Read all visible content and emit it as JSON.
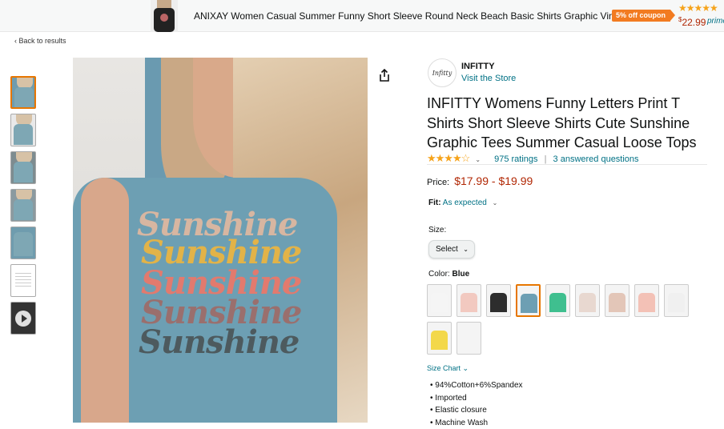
{
  "banner": {
    "title": "ANIXAY Women Casual Summer Funny Short Sleeve Round Neck Beach Basic Shirts Graphic Vintage...",
    "coupon": "5% off coupon",
    "stars": "★★★★★",
    "price_symbol": "$",
    "price": "22.99",
    "prime": "prime"
  },
  "nav": {
    "back": "‹  Back to results"
  },
  "gallery": {
    "thumbnails": [
      "Image 1",
      "Image 2",
      "Image 3",
      "Image 4",
      "Image 5",
      "Size chart",
      "Video"
    ],
    "main_words": [
      "Sunshine",
      "Sunshine",
      "Sunshine",
      "Sunshine",
      "Sunshine"
    ]
  },
  "store": {
    "logo_text": "Infitty",
    "brand": "INFITTY",
    "visit": "Visit the Store"
  },
  "product": {
    "title": "INFITTY Womens Funny Letters Print T Shirts Short Sleeve Shirts Cute Sunshine Graphic Tees Summer Casual Loose Tops",
    "stars": "★★★★☆",
    "ratings": "975 ratings",
    "questions": "3 answered questions",
    "price_label": "Price:",
    "price": "$17.99 - $19.99",
    "fit_label": "Fit:",
    "fit_value": "As expected",
    "size_label": "Size:",
    "size_select": "Select",
    "color_label": "Color:",
    "color_value": "Blue",
    "size_chart": "Size Chart",
    "bullets": [
      "94%Cotton+6%Spandex",
      "Imported",
      "Elastic closure",
      "Machine Wash"
    ]
  },
  "colors": {
    "accent_orange": "#e77600",
    "link": "#007185",
    "price": "#b12704",
    "star": "#f6a31a",
    "swatches": [
      "#f5f5f5",
      "#f2c9c0",
      "#2d2d2d",
      "#6d9fb3",
      "#3fbf8f",
      "#e8d8d0",
      "#e3c6b8",
      "#f3c1b6",
      "#f0f0f0",
      "#f3d84a",
      "#f4f4f4"
    ]
  }
}
